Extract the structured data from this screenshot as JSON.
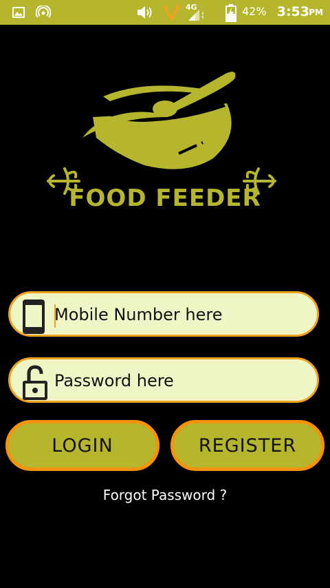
{
  "status_bar": {
    "battery": "42%",
    "network": "4G",
    "time": "3:53",
    "ampm": "PM",
    "icons": [
      "image-icon",
      "hotspot-icon",
      "volume-icon",
      "carrier-v-icon",
      "signal-icon",
      "battery-charging-icon"
    ]
  },
  "brand": {
    "name": "FOOD FEEDER",
    "accent_color": "#b5b62d",
    "logo_icon": "bowl-spoon-fork-icon"
  },
  "form": {
    "mobile_placeholder": "Mobile Number here",
    "password_placeholder": "Password here",
    "mobile_icon": "phone-icon",
    "password_icon": "lock-icon"
  },
  "buttons": {
    "login_label": "LOGIN",
    "register_label": "REGISTER"
  },
  "links": {
    "forgot_password": "Forgot Password ?"
  },
  "colors": {
    "field_bg": "#f0f5c6",
    "field_border": "#f0a11f",
    "button_border": "#f5920a"
  }
}
